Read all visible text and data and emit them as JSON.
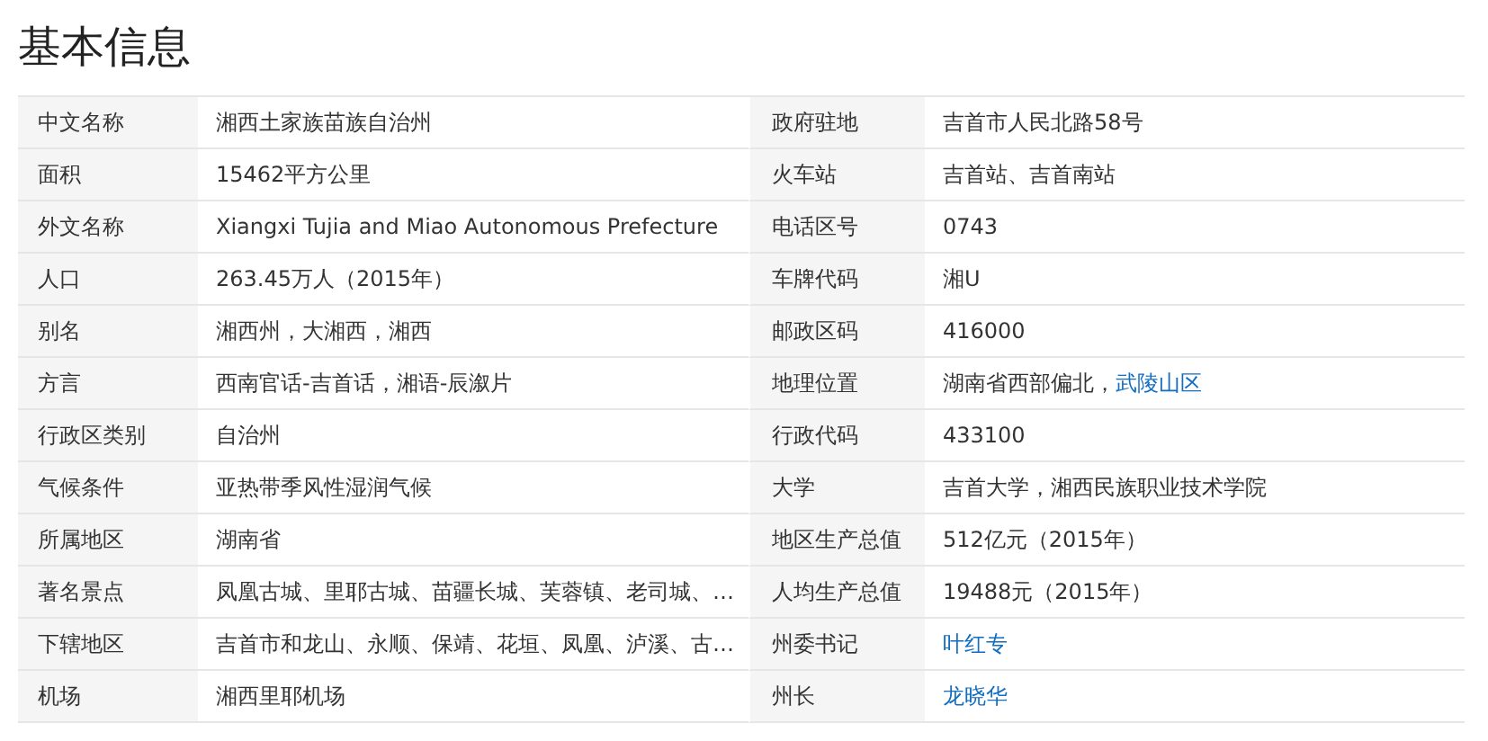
{
  "title": "基本信息",
  "rows": [
    {
      "left": {
        "label": "中文名称",
        "value": [
          {
            "text": "湘西土家族苗族自治州",
            "link": false
          }
        ]
      },
      "right": {
        "label": "政府驻地",
        "value": [
          {
            "text": "吉首市人民北路58号",
            "link": false
          }
        ]
      }
    },
    {
      "left": {
        "label": "面积",
        "value": [
          {
            "text": "15462平方公里",
            "link": false
          }
        ]
      },
      "right": {
        "label": "火车站",
        "value": [
          {
            "text": "吉首站、吉首南站",
            "link": false
          }
        ]
      }
    },
    {
      "left": {
        "label": "外文名称",
        "value": [
          {
            "text": "Xiangxi Tujia and Miao Autonomous Prefecture",
            "link": false
          }
        ]
      },
      "right": {
        "label": "电话区号",
        "value": [
          {
            "text": "0743",
            "link": false
          }
        ]
      }
    },
    {
      "left": {
        "label": "人口",
        "value": [
          {
            "text": "263.45万人（2015年）",
            "link": false
          }
        ]
      },
      "right": {
        "label": "车牌代码",
        "value": [
          {
            "text": "湘U",
            "link": false
          }
        ]
      }
    },
    {
      "left": {
        "label": "别名",
        "value": [
          {
            "text": "湘西州，大湘西，湘西",
            "link": false
          }
        ]
      },
      "right": {
        "label": "邮政区码",
        "value": [
          {
            "text": "416000",
            "link": false
          }
        ]
      }
    },
    {
      "left": {
        "label": "方言",
        "value": [
          {
            "text": "西南官话-吉首话，湘语-辰溆片",
            "link": false
          }
        ]
      },
      "right": {
        "label": "地理位置",
        "value": [
          {
            "text": "湖南省西部偏北，",
            "link": false
          },
          {
            "text": "武陵山区",
            "link": true
          }
        ]
      }
    },
    {
      "left": {
        "label": "行政区类别",
        "value": [
          {
            "text": "自治州",
            "link": false
          }
        ]
      },
      "right": {
        "label": "行政代码",
        "value": [
          {
            "text": "433100",
            "link": false
          }
        ]
      }
    },
    {
      "left": {
        "label": "气候条件",
        "value": [
          {
            "text": "亚热带季风性湿润气候",
            "link": false
          }
        ]
      },
      "right": {
        "label": "大学",
        "value": [
          {
            "text": "吉首大学，湘西民族职业技术学院",
            "link": false
          }
        ]
      }
    },
    {
      "left": {
        "label": "所属地区",
        "value": [
          {
            "text": "湖南省",
            "link": false
          }
        ]
      },
      "right": {
        "label": "地区生产总值",
        "value": [
          {
            "text": "512亿元（2015年）",
            "link": false
          }
        ]
      }
    },
    {
      "left": {
        "label": "著名景点",
        "value": [
          {
            "text": "凤凰古城、里耶古城、苗疆长城、芙蓉镇、老司城、…",
            "link": false
          }
        ]
      },
      "right": {
        "label": "人均生产总值",
        "value": [
          {
            "text": "19488元（2015年）",
            "link": false
          }
        ]
      }
    },
    {
      "left": {
        "label": "下辖地区",
        "value": [
          {
            "text": "吉首市和龙山、永顺、保靖、花垣、凤凰、泸溪、古…",
            "link": false
          }
        ]
      },
      "right": {
        "label": "州委书记",
        "value": [
          {
            "text": "叶红专",
            "link": true
          }
        ]
      }
    },
    {
      "left": {
        "label": "机场",
        "value": [
          {
            "text": "湘西里耶机场",
            "link": false
          }
        ]
      },
      "right": {
        "label": "州长",
        "value": [
          {
            "text": "龙晓华",
            "link": true
          }
        ]
      }
    }
  ]
}
